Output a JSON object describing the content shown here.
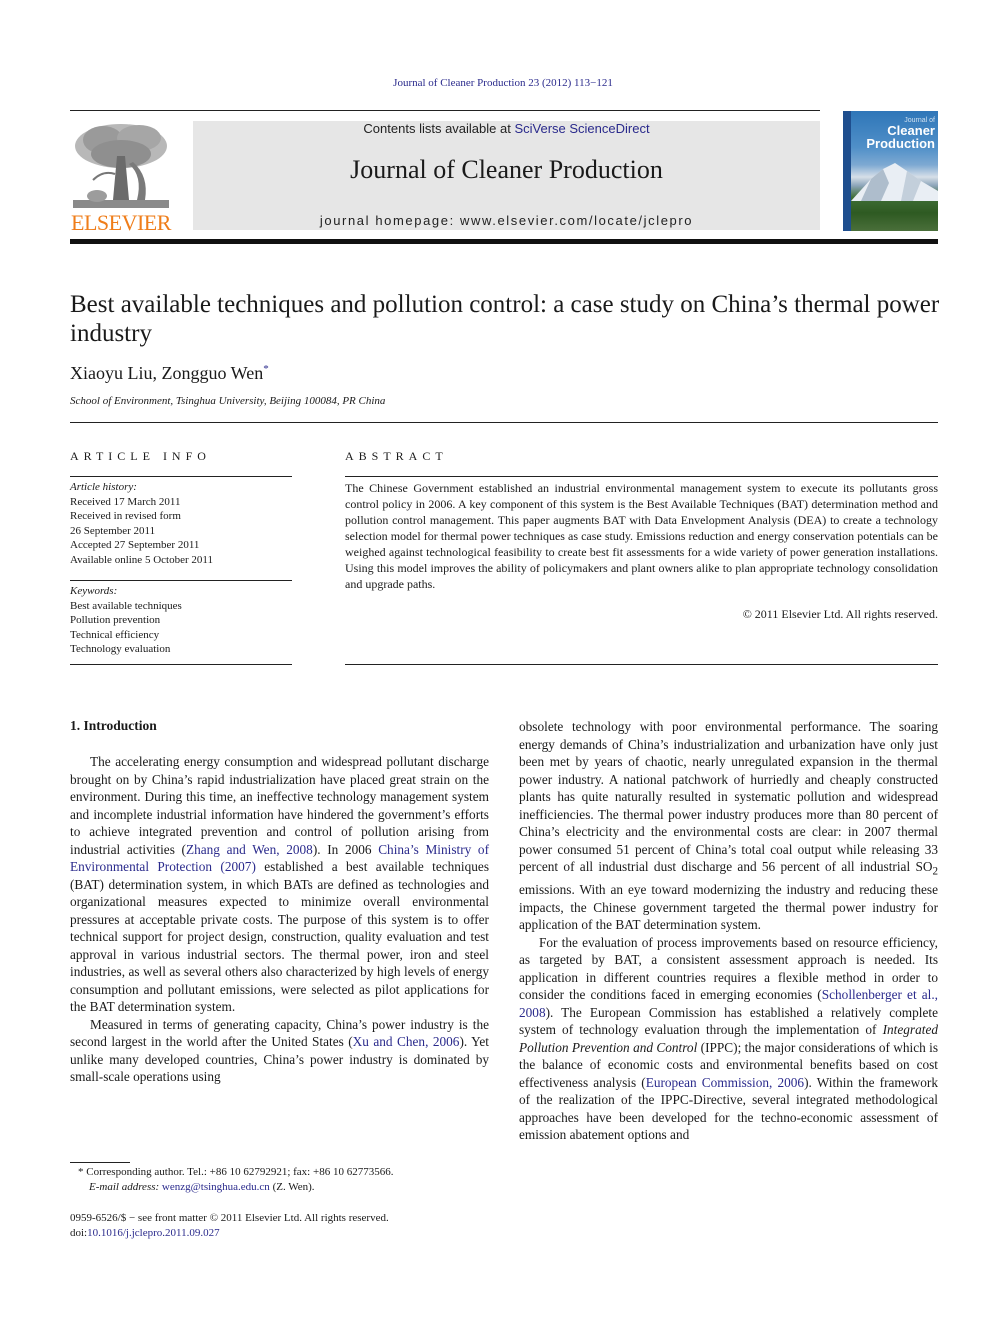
{
  "journal_ref": "Journal of Cleaner Production 23 (2012) 113−121",
  "masthead": {
    "publisher_logo": "ELSEVIER",
    "contents_prefix": "Contents lists available at ",
    "contents_link": "SciVerse ScienceDirect",
    "journal_name": "Journal of Cleaner Production",
    "homepage": "journal homepage: www.elsevier.com/locate/jclepro",
    "cover": {
      "small_title": "Journal of",
      "title_line1": "Cleaner",
      "title_line2": "Production"
    }
  },
  "article": {
    "title": "Best available techniques and pollution control: a case study on China’s thermal power industry",
    "authors": "Xiaoyu Liu, Zongguo Wen",
    "author_mark": "*",
    "affiliation": "School of Environment, Tsinghua University, Beijing 100084, PR China"
  },
  "article_info": {
    "label": "ARTICLE INFO",
    "history_heading": "Article history:",
    "history": [
      "Received 17 March 2011",
      "Received in revised form",
      "26 September 2011",
      "Accepted 27 September 2011",
      "Available online 5 October 2011"
    ],
    "keywords_heading": "Keywords:",
    "keywords": [
      "Best available techniques",
      "Pollution prevention",
      "Technical efficiency",
      "Technology evaluation"
    ]
  },
  "abstract": {
    "label": "ABSTRACT",
    "text": "The Chinese Government established an industrial environmental management system to execute its pollutants gross control policy in 2006. A key component of this system is the Best Available Techniques (BAT) determination method and pollution control management. This paper augments BAT with Data Envelopment Analysis (DEA) to create a technology selection model for thermal power techniques as case study. Emissions reduction and energy conservation potentials can be weighed against technological feasibility to create best fit assessments for a wide variety of power generation installations. Using this model improves the ability of policymakers and plant owners alike to plan appropriate technology consolidation and upgrade paths.",
    "copyright": "© 2011 Elsevier Ltd. All rights reserved."
  },
  "body": {
    "section_heading": "1.  Introduction",
    "left": {
      "p1_a": "The accelerating energy consumption and widespread pollutant discharge brought on by China’s rapid industrialization have placed great strain on the environment. During this time, an ineffective technology management system and incomplete industrial information have hindered the government’s efforts to achieve integrated prevention and control of pollution arising from industrial activities (",
      "p1_ref1": "Zhang and Wen, 2008",
      "p1_b": "). In 2006 ",
      "p1_ref2": "China’s Ministry of Environmental Protection (2007)",
      "p1_c": " established a best available techniques (BAT) determination system, in which BATs are defined as technologies and organizational measures expected to minimize overall environmental pressures at acceptable private costs. The purpose of this system is to offer technical support for project design, construction, quality evaluation and test approval in various industrial sectors. The thermal power, iron and steel industries, as well as several others also characterized by high levels of energy consumption and pollutant emissions, were selected as pilot applications for the BAT determination system.",
      "p2_a": "Measured in terms of generating capacity, China’s power industry is the second largest in the world after the United States (",
      "p2_ref1": "Xu and Chen, 2006",
      "p2_b": "). Yet unlike many developed countries, China’s power industry is dominated by small-scale operations using"
    },
    "right": {
      "p1_a": "obsolete technology with poor environmental performance. The soaring energy demands of China’s industrialization and urbanization have only just been met by years of chaotic, nearly unregulated expansion in the thermal power industry. A national patchwork of hurriedly and cheaply constructed plants has quite naturally resulted in systematic pollution and widespread inefficiencies. The thermal power industry produces more than 80 percent of China’s electricity and the environmental costs are clear: in 2007 thermal power consumed 51 percent of China’s total coal output while releasing 33 percent of all industrial dust discharge and 56 percent of all industrial SO",
      "p1_sub": "2",
      "p1_b": " emissions. With an eye toward modernizing the industry and reducing these impacts, the Chinese government targeted the thermal power industry for application of the BAT determination system.",
      "p2_a": "For the evaluation of process improvements based on resource efficiency, as targeted by BAT, a consistent assessment approach is needed. Its application in different countries requires a flexible method in order to consider the conditions faced in emerging economies (",
      "p2_ref1": "Schollenberger et al., 2008",
      "p2_b": "). The European Commission has established a relatively complete system of technology evaluation through the implementation of ",
      "p2_italic": "Integrated Pollution Prevention and Control",
      "p2_c": " (IPPC); the major considerations of which is the balance of economic costs and environmental benefits based on cost effectiveness analysis (",
      "p2_ref2": "European Commission, 2006",
      "p2_d": "). Within the framework of the realization of the IPPC-Directive, several integrated methodological approaches have been developed for the techno-economic assessment of emission abatement options and"
    }
  },
  "footnote": {
    "mark": "*",
    "corresponding": " Corresponding author. Tel.: +86 10 62792921; fax: +86 10 62773566.",
    "email_label": "E-mail address: ",
    "email": "wenzg@tsinghua.edu.cn",
    "email_suffix": " (Z. Wen)."
  },
  "front_matter": {
    "issn_line": "0959-6526/$ − see front matter © 2011 Elsevier Ltd. All rights reserved.",
    "doi_prefix": "doi:",
    "doi": "10.1016/j.jclepro.2011.09.027"
  },
  "colors": {
    "link": "#2a2a8c",
    "elsevier_orange": "#ef7d1a",
    "masthead_bg": "#e6e6e6"
  }
}
